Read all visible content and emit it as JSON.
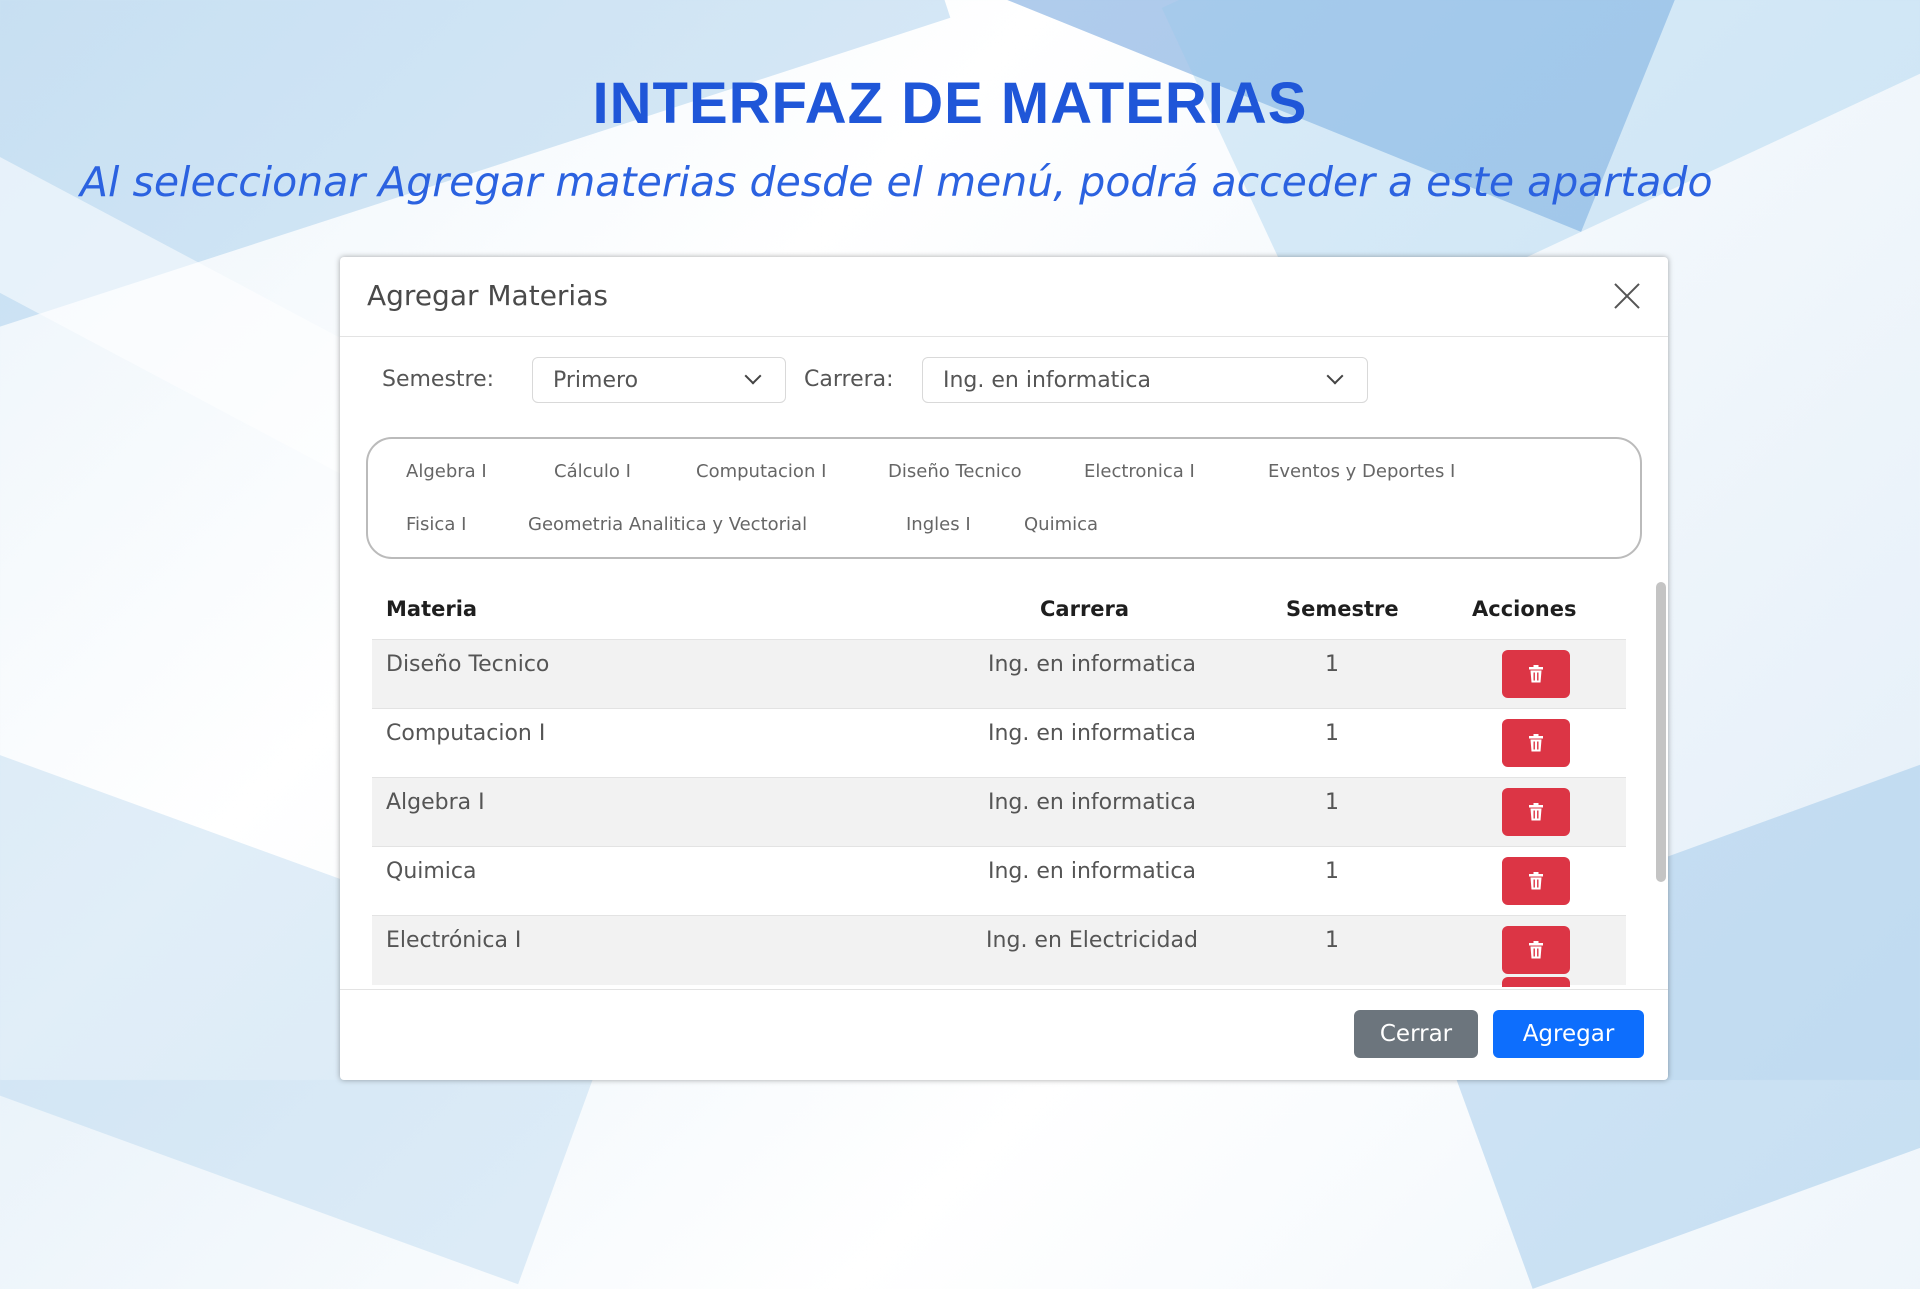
{
  "slide": {
    "title": "INTERFAZ DE MATERIAS",
    "subtitle": "Al seleccionar Agregar materias desde el menú, podrá acceder a este apartado"
  },
  "modal": {
    "title": "Agregar Materias",
    "filters": {
      "semestre_label": "Semestre:",
      "semestre_value": "Primero",
      "carrera_label": "Carrera:",
      "carrera_value": "Ing. en informatica"
    },
    "chips": [
      "Algebra I",
      "Cálculo I",
      "Computacion I",
      "Diseño Tecnico",
      "Electronica I",
      "Eventos y Deportes I",
      "Fisica I",
      "Geometria Analitica y Vectorial",
      "Ingles I",
      "Quimica"
    ],
    "table": {
      "headers": {
        "materia": "Materia",
        "carrera": "Carrera",
        "semestre": "Semestre",
        "acciones": "Acciones"
      },
      "rows": [
        {
          "materia": "Diseño Tecnico",
          "carrera": "Ing. en informatica",
          "semestre": "1"
        },
        {
          "materia": "Computacion I",
          "carrera": "Ing. en informatica",
          "semestre": "1"
        },
        {
          "materia": "Algebra I",
          "carrera": "Ing. en informatica",
          "semestre": "1"
        },
        {
          "materia": "Quimica",
          "carrera": "Ing. en informatica",
          "semestre": "1"
        },
        {
          "materia": "Electrónica I",
          "carrera": "Ing. en Electricidad",
          "semestre": "1"
        }
      ]
    },
    "buttons": {
      "close": "Cerrar",
      "add": "Agregar"
    },
    "colors": {
      "primary": "#0d6efd",
      "danger": "#dc3545",
      "secondary": "#6c757d",
      "title_blue": "#1f56d8"
    }
  }
}
